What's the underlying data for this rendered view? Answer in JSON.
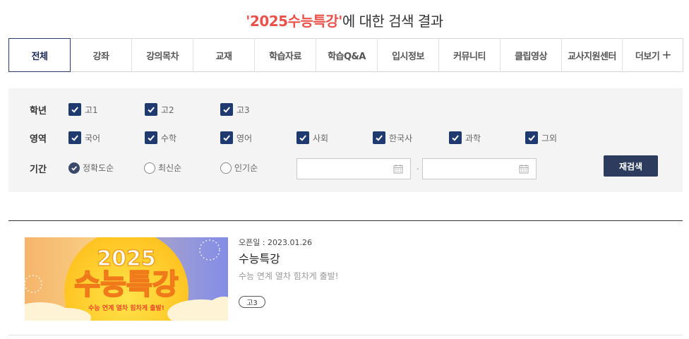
{
  "heading": {
    "quote_open": "'",
    "keyword": "2025수능특강",
    "quote_close": "'",
    "suffix": "에 대한 검색 결과"
  },
  "tabs": [
    {
      "label": "전체",
      "active": true
    },
    {
      "label": "강좌"
    },
    {
      "label": "강의목차"
    },
    {
      "label": "교재"
    },
    {
      "label": "학습자료"
    },
    {
      "label": "학습Q&A"
    },
    {
      "label": "입시정보"
    },
    {
      "label": "커뮤니티"
    },
    {
      "label": "클립영상"
    },
    {
      "label": "교사지원센터"
    },
    {
      "label": "더보기",
      "plus": "+"
    }
  ],
  "filter": {
    "grade_label": "학년",
    "grades": [
      "고1",
      "고2",
      "고3"
    ],
    "area_label": "영역",
    "areas": [
      "국어",
      "수학",
      "영어",
      "사회",
      "한국사",
      "과학",
      "그외"
    ],
    "period_label": "기간",
    "sorts": [
      "정확도순",
      "최신순",
      "인기순"
    ],
    "selected_sort": "정확도순",
    "date_separator": "-",
    "research_button": "재검색"
  },
  "result": {
    "open_date": "오픈일 : 2023.01.26",
    "title": "수능특강",
    "description": "수능 연계 열차 힘차게 출발!",
    "badge": "고3",
    "thumbnail": {
      "year": "2025",
      "title": "수능특강",
      "caption": "수능 연계 열차 힘차게 출발!"
    }
  },
  "colors": {
    "accent": "#e8524a",
    "navy": "#1f3a6e",
    "button": "#2c3b5e"
  },
  "icons": {
    "checkbox": "check-icon",
    "date": "calendar-icon",
    "more": "plus-icon"
  }
}
